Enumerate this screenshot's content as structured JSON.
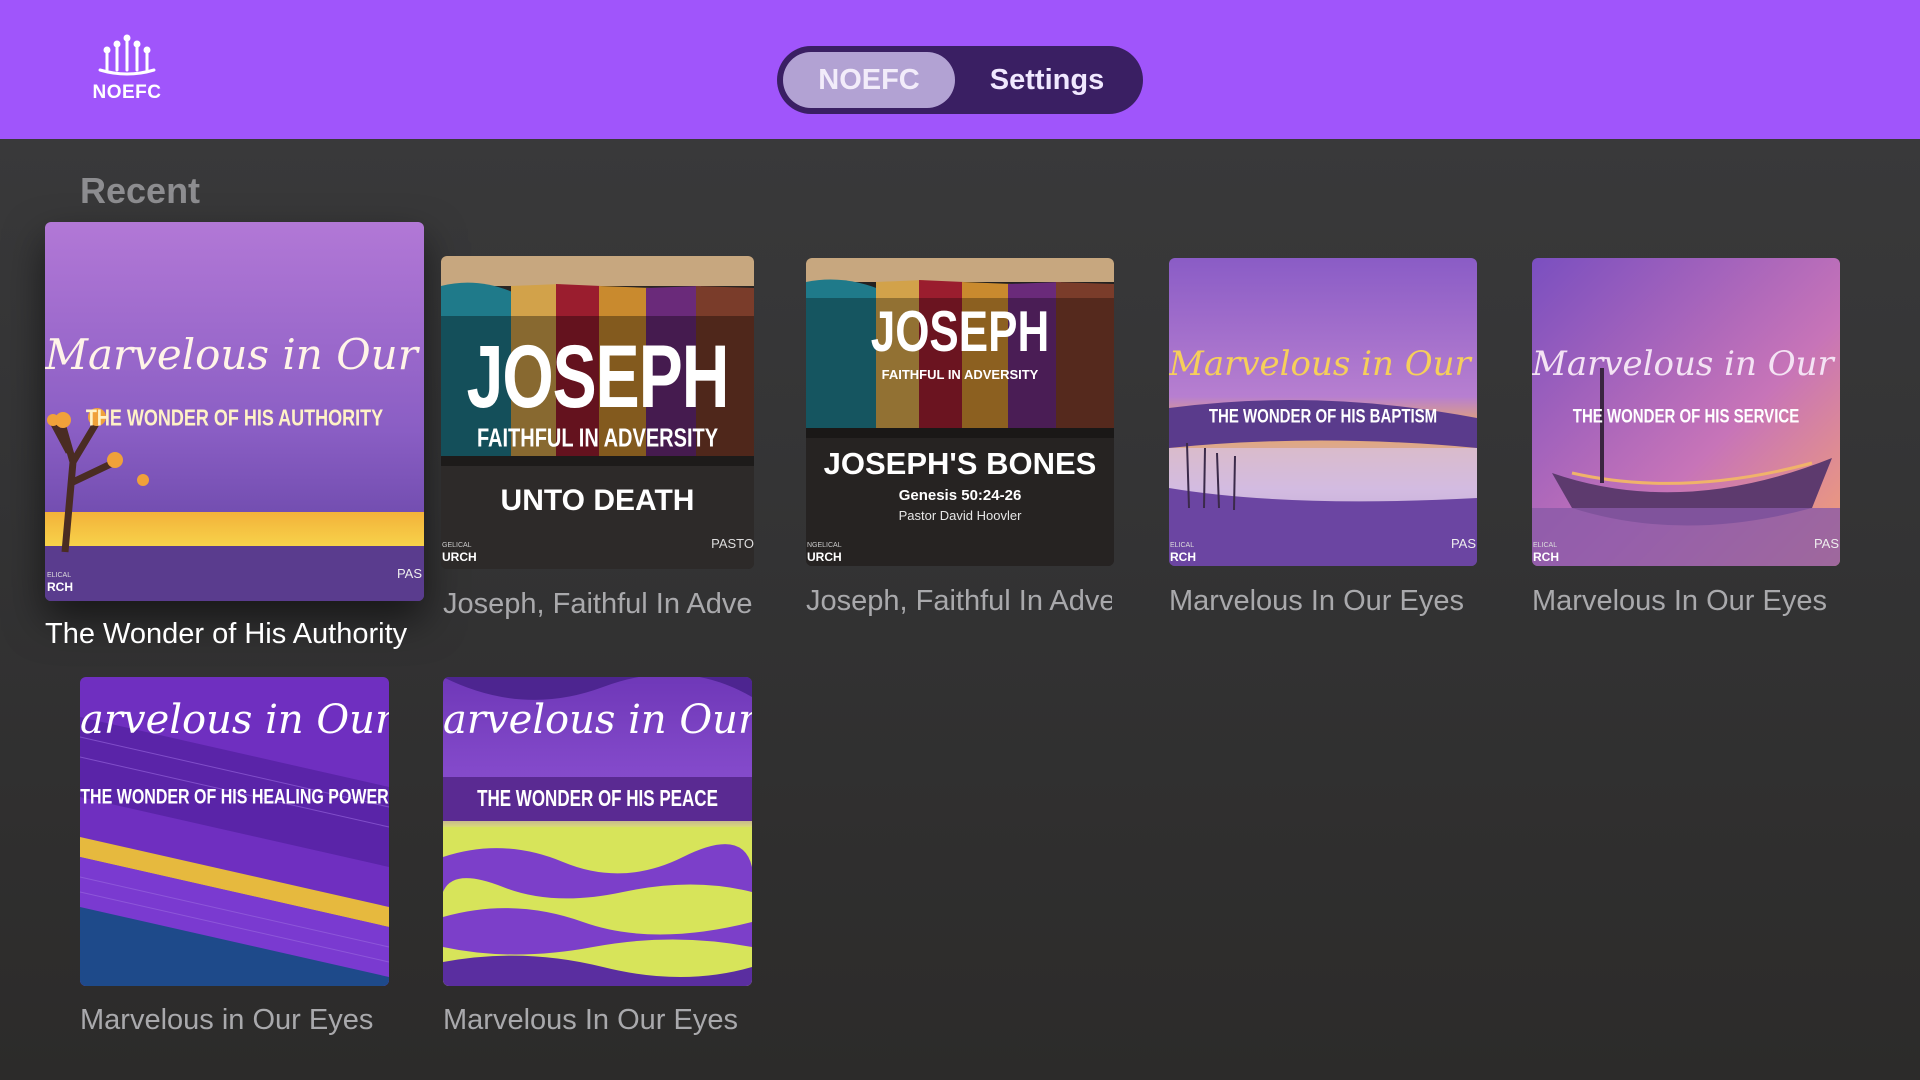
{
  "header": {
    "logo_text": "NOEFC",
    "tabs": [
      {
        "label": "NOEFC",
        "selected": true
      },
      {
        "label": "Settings",
        "selected": false
      }
    ],
    "background_color": "#a055fb"
  },
  "section": {
    "title": "Recent"
  },
  "items": [
    {
      "label": "The Wonder of His Authority",
      "focused": true,
      "art": {
        "script_title": "Marvelous in Our Eyes",
        "subtitle": "THE WONDER OF HIS AUTHORITY",
        "edge_left": "RCH",
        "edge_left_small": "ELICAL",
        "edge_right": "PAS"
      }
    },
    {
      "label": "Joseph, Faithful In Adversity",
      "focused": false,
      "art": {
        "title": "JOSEPH",
        "subtitle": "FAITHFUL IN ADVERSITY",
        "episode": "UNTO DEATH",
        "edge_left": "URCH",
        "edge_left_small": "GELICAL",
        "edge_right": "PASTO"
      }
    },
    {
      "label": "Joseph, Faithful In Adversity",
      "focused": false,
      "art": {
        "title": "JOSEPH",
        "subtitle": "FAITHFUL IN ADVERSITY",
        "episode": "JOSEPH'S BONES",
        "reference": "Genesis 50:24-26",
        "speaker": "Pastor David Hoovler",
        "edge_left": "URCH",
        "edge_left_small": "NGELICAL"
      }
    },
    {
      "label": "Marvelous In Our Eyes",
      "focused": false,
      "art": {
        "script_title": "Marvelous in Our Eyes",
        "subtitle": "THE WONDER OF HIS BAPTISM",
        "edge_left": "RCH",
        "edge_left_small": "ELICAL",
        "edge_right": "PAS"
      }
    },
    {
      "label": "Marvelous In Our Eyes",
      "focused": false,
      "art": {
        "script_title": "Marvelous in Our Eyes",
        "subtitle": "THE WONDER OF HIS SERVICE",
        "edge_left": "RCH",
        "edge_left_small": "ELICAL",
        "edge_right": "PAS"
      }
    },
    {
      "label": "Marvelous in Our Eyes",
      "focused": false,
      "art": {
        "script_title": "arvelous in Our E",
        "subtitle": "THE WONDER OF HIS HEALING POWER"
      }
    },
    {
      "label": "Marvelous In Our Eyes",
      "focused": false,
      "art": {
        "script_title": "arvelous in Our E",
        "subtitle": "THE WONDER OF HIS PEACE"
      }
    }
  ]
}
